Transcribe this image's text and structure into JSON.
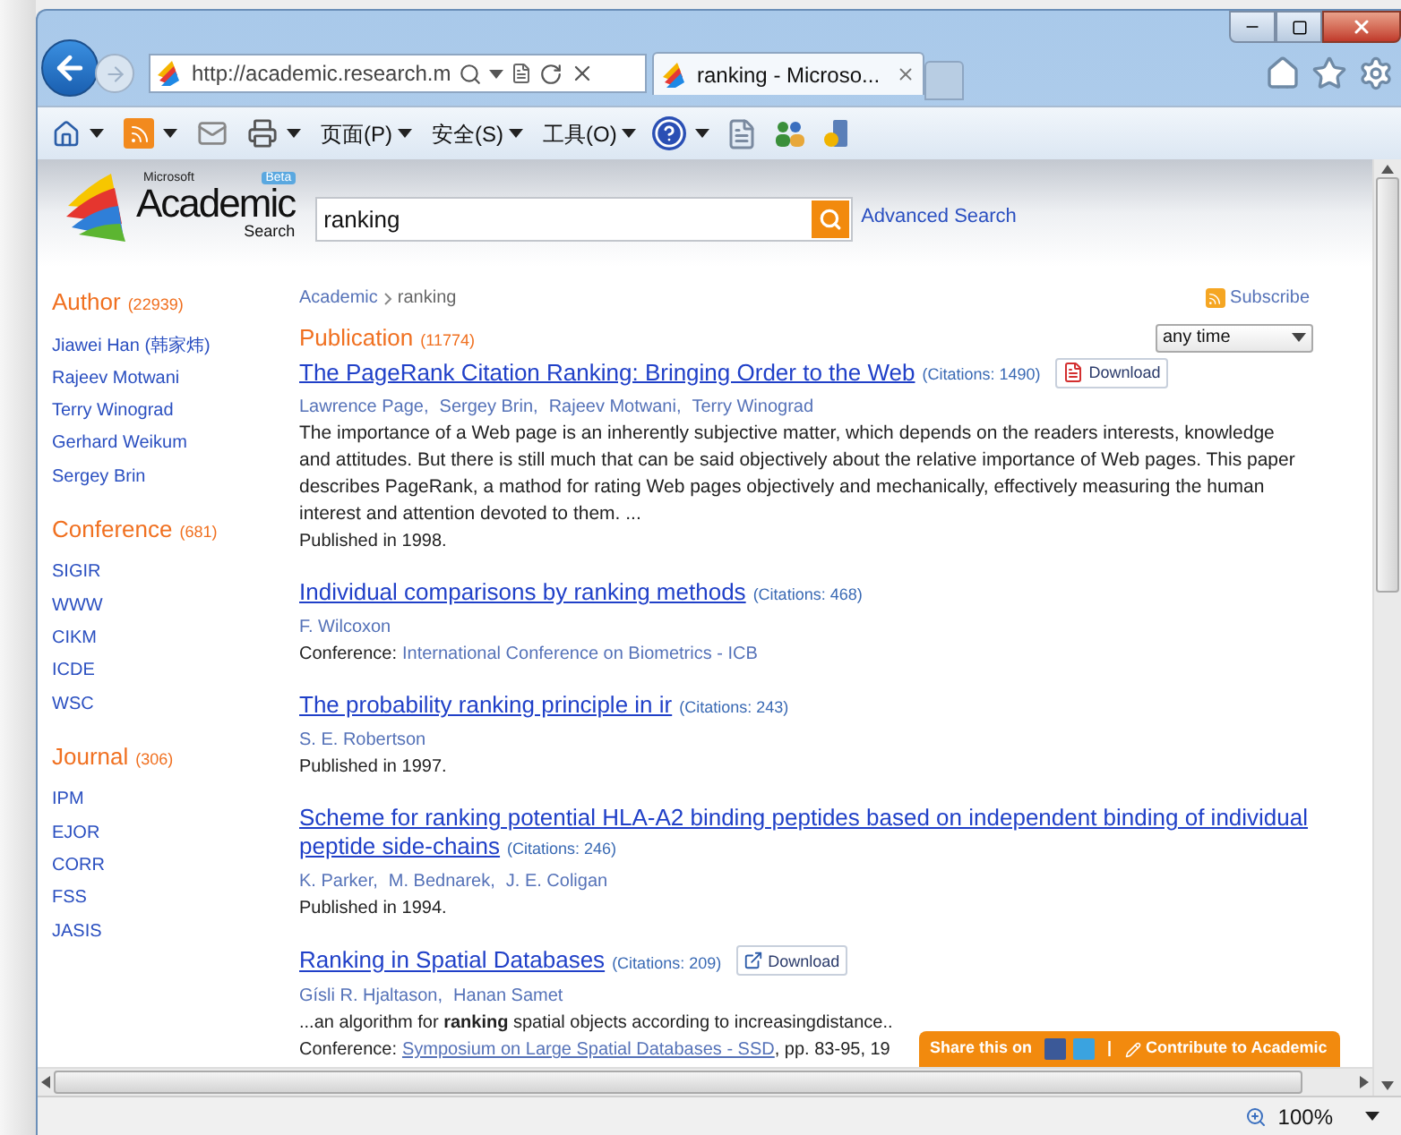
{
  "browser": {
    "address": "http://academic.research.m",
    "tabs": [
      {
        "title": "ranking - Microso...",
        "selected": true
      }
    ],
    "menus": [
      "页面(P)",
      "安全(S)",
      "工具(O)"
    ]
  },
  "logo": {
    "brand": "Microsoft",
    "name": "Academic",
    "sub": "Search",
    "badge": "Beta"
  },
  "search": {
    "value": "ranking",
    "advanced": "Advanced Search"
  },
  "facets": [
    {
      "title": "Author",
      "count": "(22939)",
      "items": [
        "Jiawei Han (韩家炜)",
        "Rajeev Motwani",
        "Terry Winograd",
        "Gerhard Weikum",
        "Sergey Brin"
      ]
    },
    {
      "title": "Conference",
      "count": "(681)",
      "items": [
        "SIGIR",
        "WWW",
        "CIKM",
        "ICDE",
        "WSC"
      ]
    },
    {
      "title": "Journal",
      "count": "(306)",
      "items": [
        "IPM",
        "EJOR",
        "CORR",
        "FSS",
        "JASIS"
      ]
    }
  ],
  "breadcrumb": [
    "Academic",
    "ranking"
  ],
  "subscribe": "Subscribe",
  "time_filter": "any time",
  "results": {
    "title": "Publication",
    "count": "(11774)",
    "items": [
      {
        "title": [
          "The PageRank Citation Ranking: Bringing Order to the Web"
        ],
        "citations": "(Citations: 1490)",
        "download": {
          "kind": "pdf",
          "label": "Download"
        },
        "authors": [
          "Lawrence Page,",
          "Sergey Brin,",
          "Rajeev Motwani,",
          "Terry Winograd"
        ],
        "abstract": "The importance of a Web page is an inherently subjective matter, which depends on the readers interests, knowledge and attitudes. But there is still much that can be said objectively about the relative importance of Web pages. This paper describes PageRank, a mathod for rating Web pages objectively and mechanically, effectively measuring the human interest and attention devoted to them. ...",
        "published": "Published in 1998."
      },
      {
        "title": [
          "Individual comparisons by ranking methods"
        ],
        "citations": "(Citations: 468)",
        "authors": [
          "F. Wilcoxon"
        ],
        "venue": {
          "label": "Conference:",
          "name": "International Conference on Biometrics - ICB"
        }
      },
      {
        "title": [
          "The probability ranking principle in ir"
        ],
        "citations": "(Citations: 243)",
        "authors": [
          "S. E. Robertson"
        ],
        "published": "Published in 1997."
      },
      {
        "title": [
          "Scheme for ranking potential HLA-A2 binding peptides based on independent binding of individual",
          "peptide side-chains"
        ],
        "citations": "(Citations: 246)",
        "authors": [
          "K. Parker,",
          "M. Bednarek,",
          "J. E. Coligan"
        ],
        "published": "Published in 1994."
      },
      {
        "title": [
          "Ranking in Spatial Databases"
        ],
        "citations": "(Citations: 209)",
        "download": {
          "kind": "link",
          "label": "Download"
        },
        "authors": [
          "Gísli R. Hjaltason,",
          "Hanan Samet"
        ],
        "abstract": "...an algorithm for **ranking** spatial objects according to increasingdistance..",
        "venue": {
          "label": "Conference:",
          "name": "Symposium on Large Spatial Databases - SSD",
          "extra": ", pp. 83-95, 19"
        }
      }
    ]
  },
  "share": {
    "label": "Share this on",
    "separator": "|",
    "contribute": "Contribute to Academic"
  },
  "status": {
    "zoom": "100%"
  }
}
